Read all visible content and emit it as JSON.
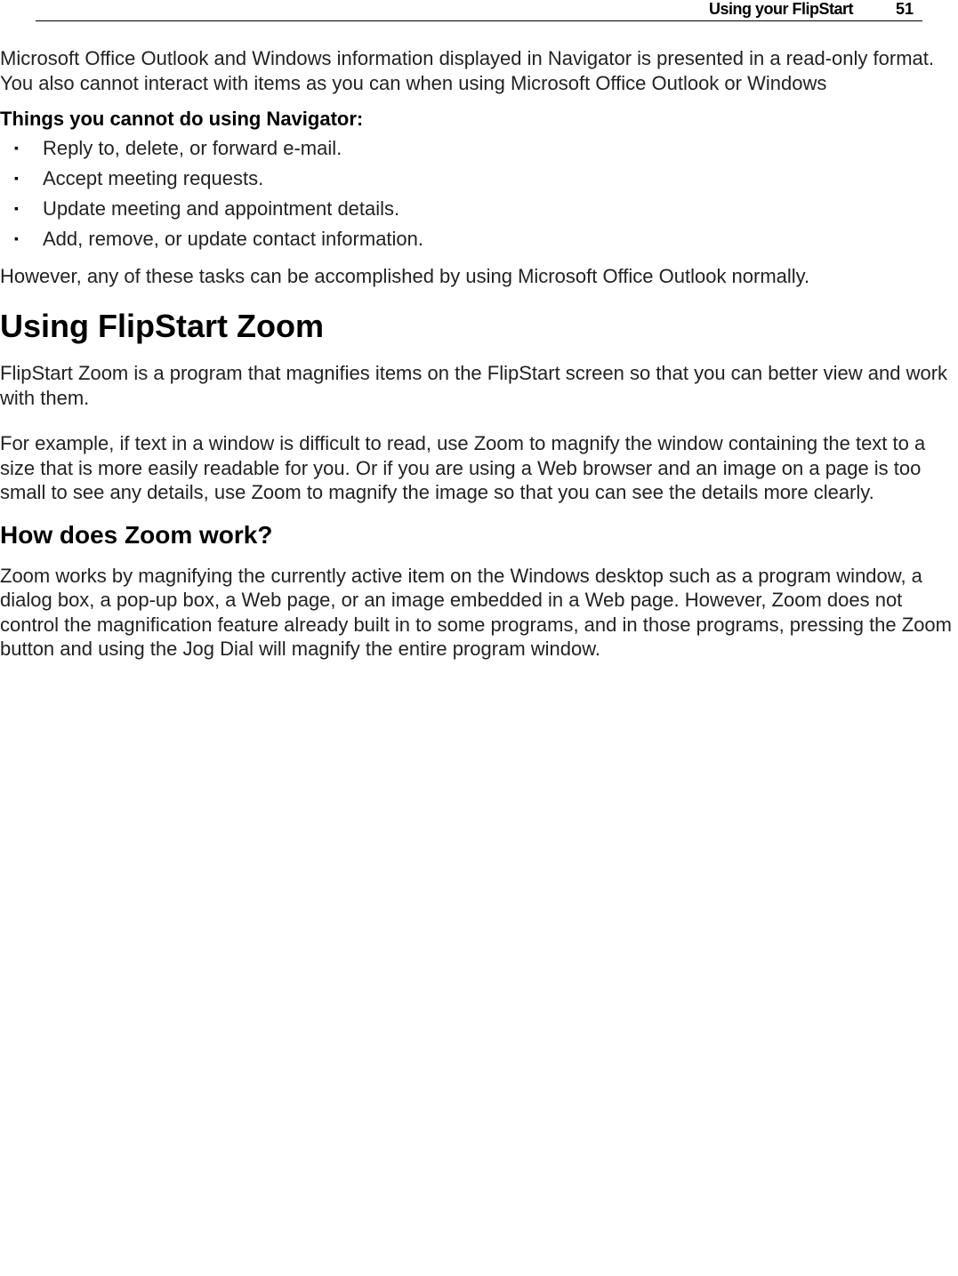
{
  "header": {
    "section_title": "Using your FlipStart",
    "page_number": "51"
  },
  "para_intro": "Microsoft Office Outlook and Windows information displayed in Navigator is presented in a read-only format. You also cannot interact with items as you can when using Microsoft Office Outlook or Windows",
  "subhead_cannot": "Things you cannot do using Navigator:",
  "cannot_items": [
    "Reply to, delete, or forward e-mail.",
    "Accept meeting requests.",
    "Update meeting and appointment details.",
    "Add, remove, or update contact information."
  ],
  "para_however": "However, any of these tasks can be accomplished by using Microsoft Office Outlook normally.",
  "h1_zoom": "Using FlipStart Zoom",
  "para_zoom1": "FlipStart Zoom is a program that magnifies items on the FlipStart screen so that you can better view and work with them.",
  "para_zoom2": "For example, if text in a window is difficult to read, use Zoom to magnify the window containing the text to a size that is more easily readable for you. Or if you are using a Web browser and an image on a page is too small to see any details, use Zoom to magnify the image so that you can see the details more clearly.",
  "h2_how": "How does Zoom work?",
  "para_how": "Zoom works by magnifying the currently active item on the Windows desktop such as a program window, a dialog box, a pop-up box, a Web page, or an image embedded in a Web page. However, Zoom does not control the magnification feature already built in to some programs, and in those programs, pressing the Zoom button and using the Jog Dial will magnify the entire program window."
}
